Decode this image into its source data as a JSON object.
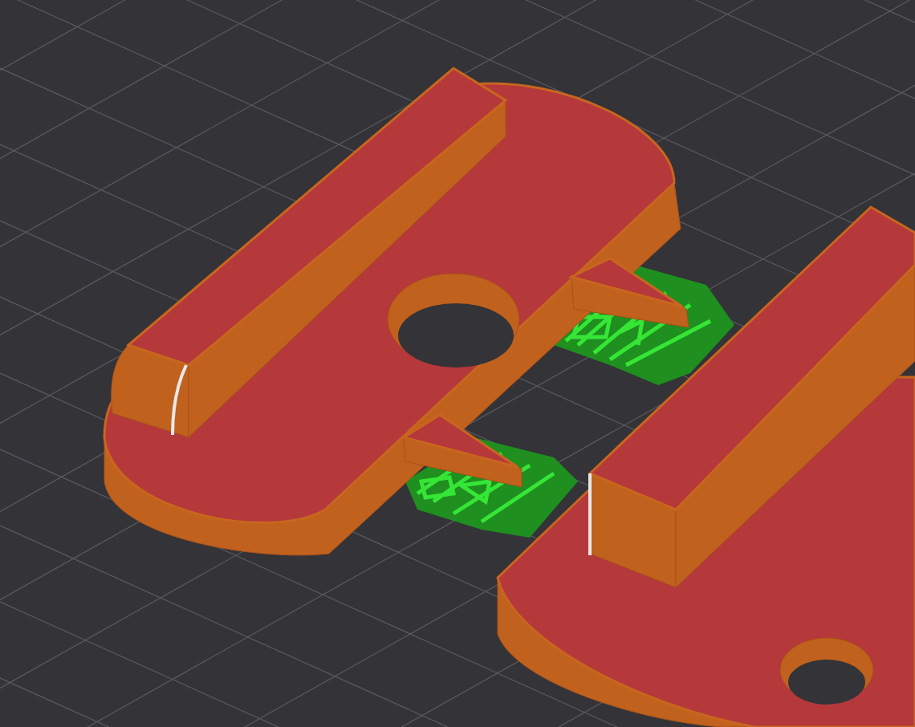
{
  "viewport": {
    "kind": "toolpath-preview",
    "grid": true
  }
}
